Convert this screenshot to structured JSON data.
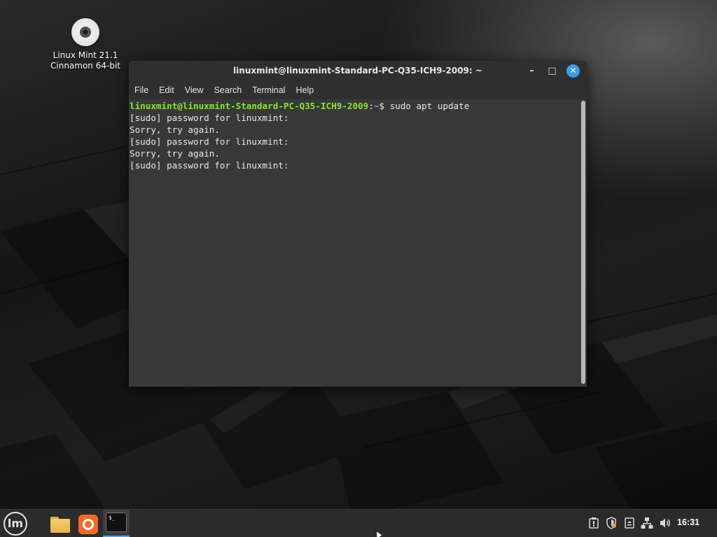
{
  "desktop": {
    "icon_label_line1": "Linux Mint 21.1",
    "icon_label_line2": "Cinnamon 64-bit"
  },
  "window": {
    "title": "linuxmint@linuxmint-Standard-PC-Q35-ICH9-2009: ~",
    "minimize_glyph": "–",
    "maximize_glyph": "□",
    "close_glyph": "✕"
  },
  "menu": {
    "items": [
      "File",
      "Edit",
      "View",
      "Search",
      "Terminal",
      "Help"
    ]
  },
  "terminal": {
    "prompt_user": "linuxmint@linuxmint-Standard-PC-Q35-ICH9-2009",
    "prompt_sep": ":",
    "prompt_path": "~",
    "prompt_symbol": "$ ",
    "command": "sudo apt update",
    "output": [
      "[sudo] password for linuxmint:",
      "Sorry, try again.",
      "[sudo] password for linuxmint:",
      "Sorry, try again.",
      "[sudo] password for linuxmint:"
    ]
  },
  "taskbar": {
    "menu_glyph": "lm",
    "terminal_glyph": "$_",
    "clock": "16:31",
    "tray_icons": [
      "update-manager-icon",
      "shield-icon",
      "notes-icon",
      "network-icon",
      "volume-icon"
    ]
  },
  "colors": {
    "prompt_user": "#8ae234",
    "prompt_path": "#729fcf",
    "close_button": "#3b9ee6",
    "active_task_indicator": "#5aa0d8"
  }
}
